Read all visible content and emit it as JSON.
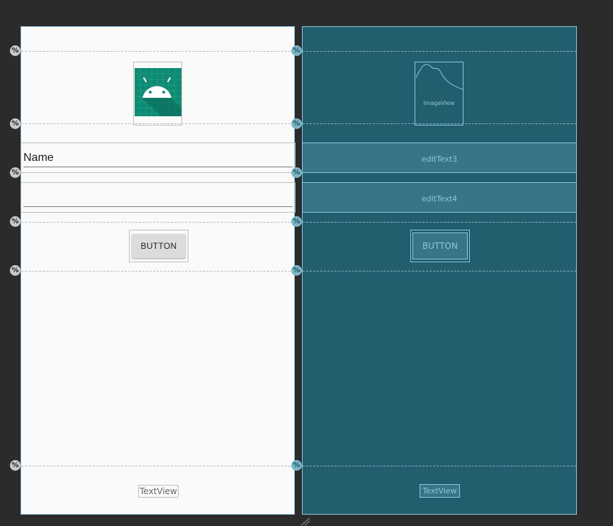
{
  "constraint_marker": "%",
  "design": {
    "edit_name_value": "Name",
    "edit_second_value": "",
    "button_label": "BUTTON",
    "textview_label": "TextView"
  },
  "blueprint": {
    "image_label": "ImageView",
    "edit3_label": "editText3",
    "edit4_label": "editText4",
    "button_label": "BUTTON",
    "textview_label": "TextView"
  },
  "colors": {
    "canvas_bg": "#2b2b2c",
    "design_bg": "#fafafa",
    "blueprint_bg": "#235e6f",
    "outline_accent": "#8cc7e0",
    "launcher_icon_teal": "#0e8a73"
  },
  "icons": [
    "android-launcher-icon",
    "percent-guideline-icon",
    "resize-handle-icon"
  ]
}
